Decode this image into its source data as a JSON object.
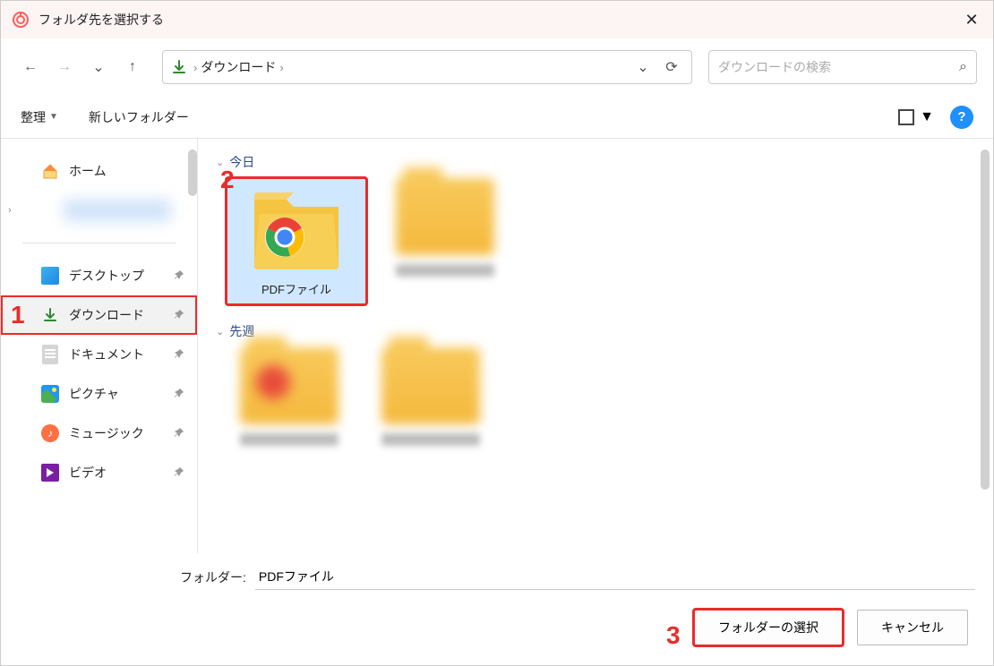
{
  "window": {
    "title": "フォルダ先を選択する",
    "close_glyph": "✕"
  },
  "nav": {
    "back_glyph": "←",
    "forward_glyph": "→",
    "recent_glyph": "⌄",
    "up_glyph": "↑"
  },
  "address": {
    "path_segment": "ダウンロード",
    "dropdown_glyph": "⌄",
    "refresh_glyph": "⟳"
  },
  "search": {
    "placeholder": "ダウンロードの検索",
    "icon_glyph": "⌕"
  },
  "toolbar": {
    "organize": "整理",
    "new_folder": "新しいフォルダー",
    "help_glyph": "?"
  },
  "sidebar": {
    "home": "ホーム",
    "desktop": "デスクトップ",
    "downloads": "ダウンロード",
    "documents": "ドキュメント",
    "pictures": "ピクチャ",
    "music": "ミュージック",
    "videos": "ビデオ",
    "pin_glyph": "📌"
  },
  "groups": {
    "today": "今日",
    "last_week": "先週"
  },
  "items": {
    "pdf_folder": "PDFファイル"
  },
  "footer": {
    "folder_label": "フォルダー:",
    "folder_value": "PDFファイル",
    "select_btn": "フォルダーの選択",
    "cancel_btn": "キャンセル"
  },
  "annotations": {
    "one": "1",
    "two": "2",
    "three": "3"
  },
  "colors": {
    "annotation_red": "#ea2b2b",
    "selection_blue": "#cfe8ff"
  }
}
